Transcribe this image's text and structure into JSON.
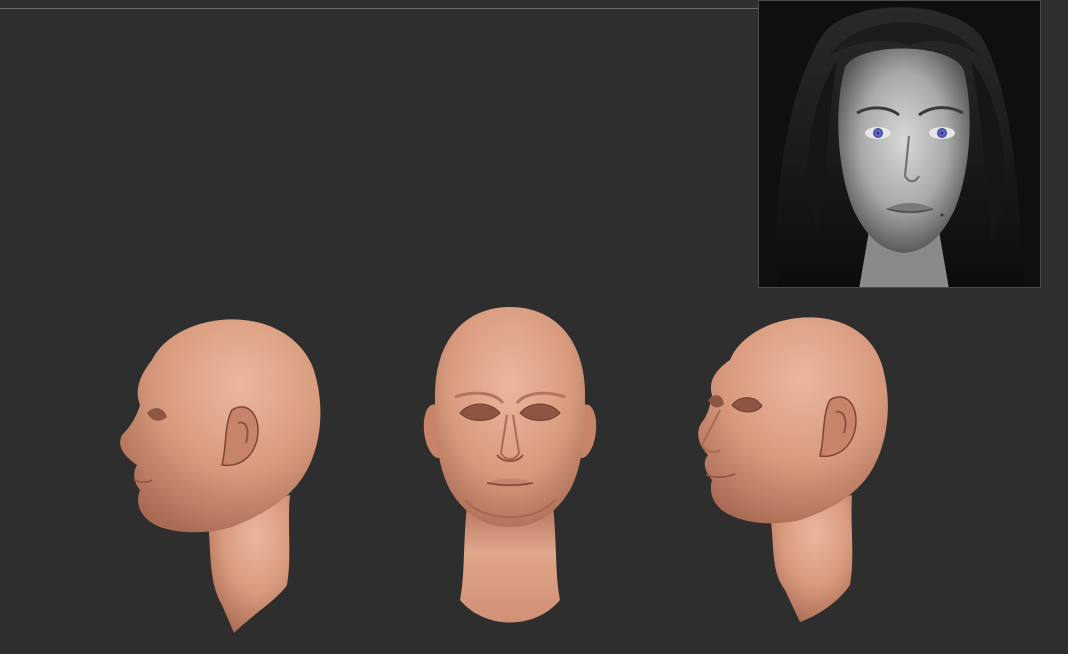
{
  "app": {
    "title": ""
  },
  "reference_image": {
    "subject": "portrait-reference",
    "tone": "grayscale",
    "eye_color": "#6a6fd6"
  },
  "views": [
    {
      "name": "head-view-left-profile",
      "orientation": "left-profile"
    },
    {
      "name": "head-view-front",
      "orientation": "front"
    },
    {
      "name": "head-view-three-quarter",
      "orientation": "three-quarter"
    }
  ],
  "colors": {
    "background": "#2e2e2e",
    "skin_base": "#d99b7e",
    "skin_light": "#e9b499",
    "skin_shadow": "#a86a52",
    "divider": "#6a6a6a"
  }
}
